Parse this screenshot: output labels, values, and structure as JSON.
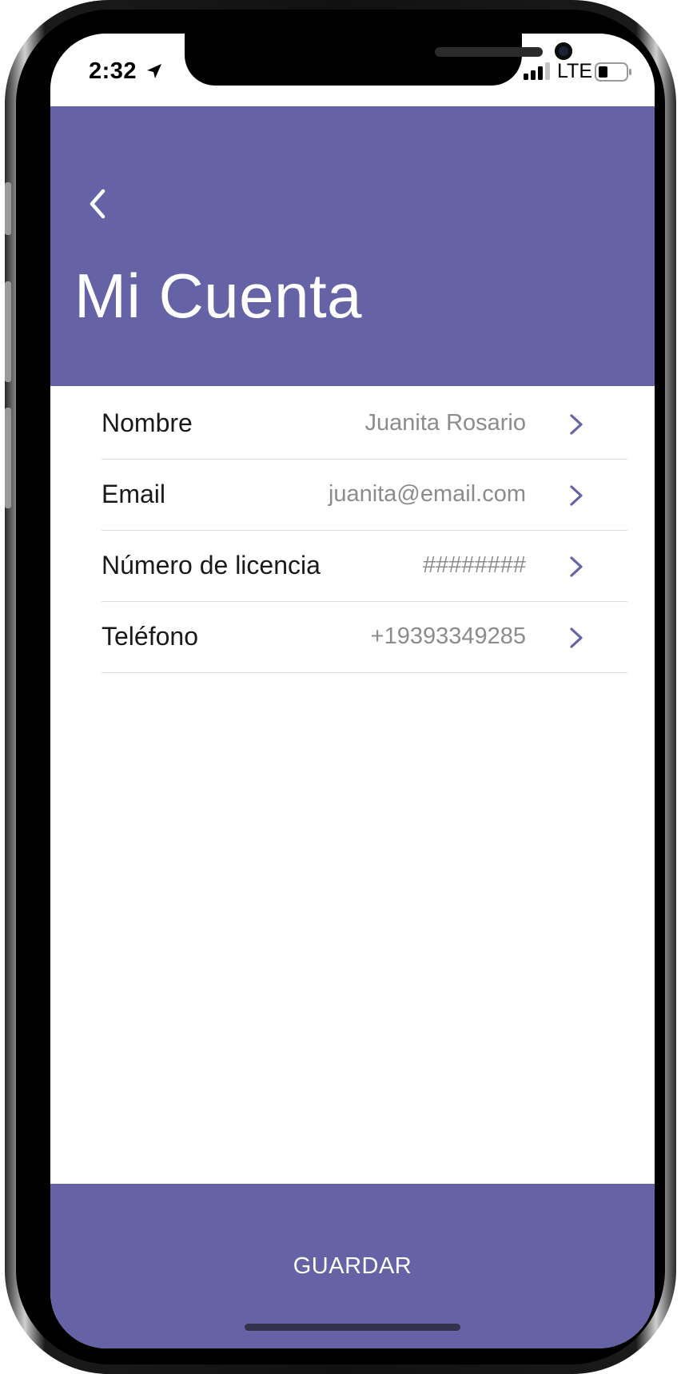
{
  "status_bar": {
    "time": "2:32",
    "network": "LTE",
    "icons": [
      "location-arrow-icon",
      "signal-bars-icon",
      "battery-icon"
    ]
  },
  "header": {
    "title": "Mi Cuenta",
    "back_icon": "chevron-left-icon"
  },
  "account_fields": [
    {
      "label": "Nombre",
      "value": "Juanita Rosario"
    },
    {
      "label": "Email",
      "value": "juanita@email.com"
    },
    {
      "label": "Número de licencia",
      "value": "########"
    },
    {
      "label": "Teléfono",
      "value": "+19393349285"
    }
  ],
  "footer": {
    "save_label": "GUARDAR"
  },
  "colors": {
    "brand": "#6662a6",
    "chevron": "#6662a6",
    "value_text": "#8c8c8c",
    "divider": "#dcdcdc"
  }
}
